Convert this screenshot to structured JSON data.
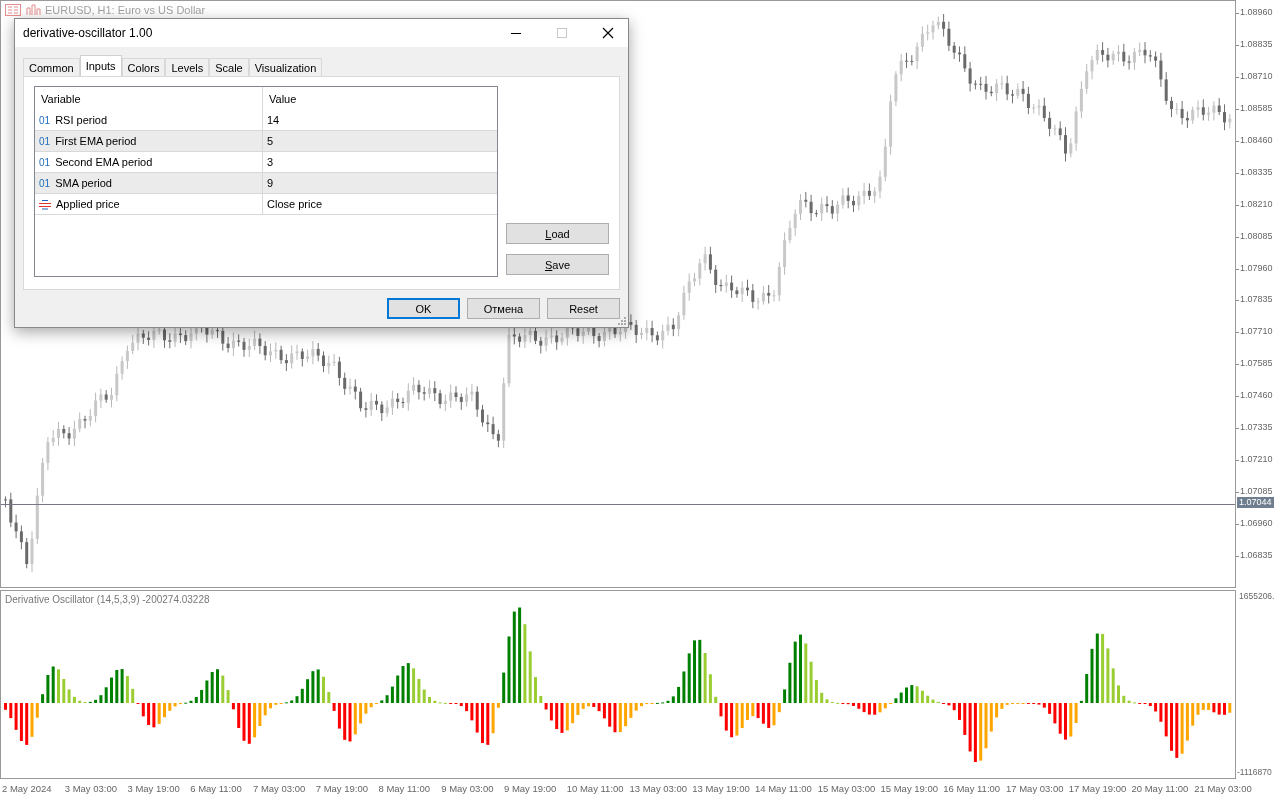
{
  "chart": {
    "title": "EURUSD, H1: Euro vs US Dollar",
    "price_labels": [
      "1.08960",
      "1.08835",
      "1.08710",
      "1.08585",
      "1.08460",
      "1.08335",
      "1.08210",
      "1.08085",
      "1.07960",
      "1.07835",
      "1.07710",
      "1.07585",
      "1.07460",
      "1.07335",
      "1.07210",
      "1.07085",
      "1.06960",
      "1.06835"
    ],
    "current_price": "1.07044"
  },
  "indicator": {
    "label": "Derivative Oscillator (14,5,3,9) -200274.03228",
    "scale_max": "1655206.",
    "scale_min": "-1116870"
  },
  "time_axis": [
    "2 May 2024",
    "3 May 03:00",
    "3 May 19:00",
    "6 May 11:00",
    "7 May 03:00",
    "7 May 19:00",
    "8 May 11:00",
    "9 May 03:00",
    "9 May 19:00",
    "10 May 11:00",
    "13 May 03:00",
    "13 May 19:00",
    "14 May 11:00",
    "15 May 03:00",
    "15 May 19:00",
    "16 May 11:00",
    "17 May 03:00",
    "17 May 19:00",
    "20 May 11:00",
    "21 May 03:00"
  ],
  "dialog": {
    "title": "derivative-oscillator 1.00",
    "tabs": [
      {
        "label": "Common",
        "selected": false
      },
      {
        "label": "Inputs",
        "selected": true
      },
      {
        "label": "Colors",
        "selected": false
      },
      {
        "label": "Levels",
        "selected": false
      },
      {
        "label": "Scale",
        "selected": false
      },
      {
        "label": "Visualization",
        "selected": false
      }
    ],
    "columns": [
      "Variable",
      "Value"
    ],
    "rows": [
      {
        "kind": "int",
        "type_mark": "01",
        "name": "RSI period",
        "value": "14"
      },
      {
        "kind": "int",
        "type_mark": "01",
        "name": "First EMA period",
        "value": "5"
      },
      {
        "kind": "int",
        "type_mark": "01",
        "name": "Second EMA period",
        "value": "3"
      },
      {
        "kind": "int",
        "type_mark": "01",
        "name": "SMA period",
        "value": "9"
      },
      {
        "kind": "enum",
        "name": "Applied price",
        "value": "Close price"
      }
    ],
    "side_buttons": [
      "Load",
      "Save"
    ],
    "buttons": [
      {
        "label": "OK",
        "default": true
      },
      {
        "label": "Отмена",
        "default": false
      },
      {
        "label": "Reset",
        "default": false
      }
    ]
  }
}
